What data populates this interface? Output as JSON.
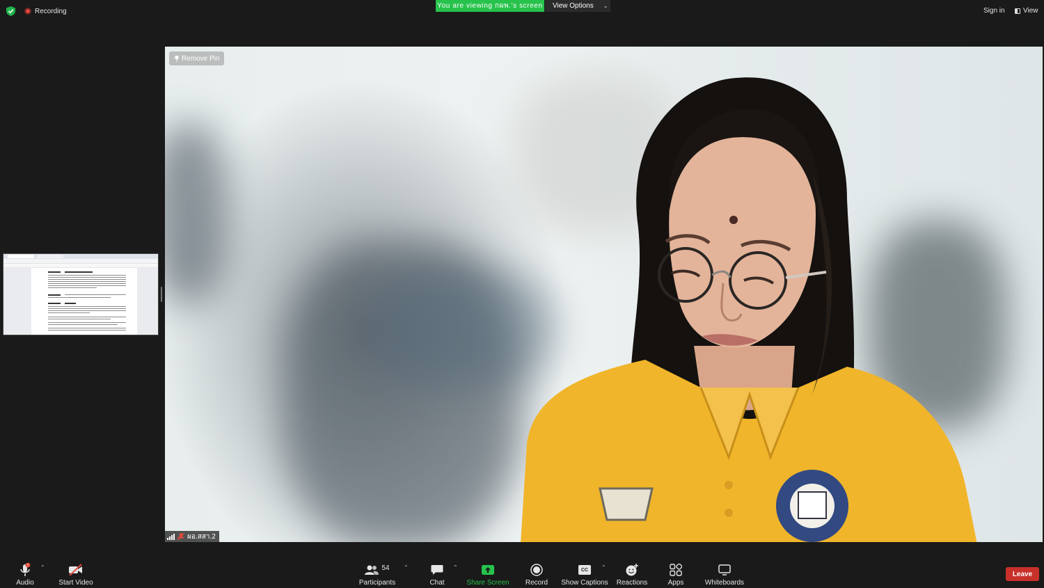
{
  "topbar": {
    "recording_label": "Recording",
    "viewing_banner": "You are viewing กผพ.'s screen",
    "view_options_label": "View Options",
    "sign_in_label": "Sign in",
    "view_label": "View"
  },
  "main_video": {
    "remove_pin_label": "Remove Pin",
    "participant_name": "ผอ.สสา.2"
  },
  "toolbar": {
    "audio_label": "Audio",
    "audio_badge": "!",
    "start_video_label": "Start Video",
    "participants_label": "Participants",
    "participants_count": "54",
    "chat_label": "Chat",
    "share_screen_label": "Share Screen",
    "record_label": "Record",
    "captions_label": "Show Captions",
    "captions_icon_text": "CC",
    "reactions_label": "Reactions",
    "apps_label": "Apps",
    "whiteboards_label": "Whiteboards",
    "leave_label": "Leave"
  },
  "colors": {
    "share_green": "#27c24c",
    "leave_red": "#c8312a",
    "background": "#1a1a1a",
    "shirt_yellow": "#f0b52a"
  },
  "icons": [
    "shield-check-icon",
    "record-dot-icon",
    "chevron-down-icon",
    "view-layout-icon",
    "pin-icon",
    "signal-icon",
    "mic-muted-icon",
    "microphone-icon",
    "video-off-icon",
    "participants-icon",
    "chat-icon",
    "share-screen-icon",
    "record-icon",
    "captions-icon",
    "reactions-icon",
    "apps-icon",
    "whiteboard-icon"
  ]
}
